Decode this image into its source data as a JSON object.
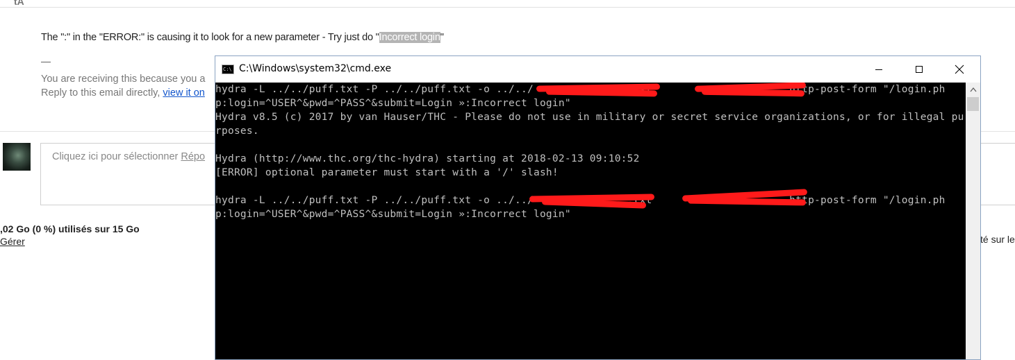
{
  "email": {
    "top_icon": "tA",
    "body_prefix": "The \":\" in the \"ERROR:\" is causing it to look for a new parameter - Try just do \"",
    "body_highlight": "Incorrect login",
    "body_suffix": "\"",
    "signature_dash": "—",
    "notice_line1": "You are receiving this because you a",
    "notice_line2_prefix": "Reply to this email directly, ",
    "notice_link": "view it on",
    "reply_placeholder_prefix": "Cliquez ici pour sélectionner ",
    "reply_placeholder_underlined": "Répo",
    "storage_text": ",02 Go (0 %) utilisés sur 15 Go",
    "manage_link": "Gérer",
    "right_clip": "té sur le"
  },
  "cmd": {
    "title": "C:\\Windows\\system32\\cmd.exe",
    "icon_text": "C:\\",
    "lines": [
      "hydra -L ../../puff.txt -P ../../puff.txt -o ../../               .txt                      http-post-form \"/login.ph",
      "p:login=^USER^&pwd=^PASS^&submit=Login »:Incorrect login\"",
      "Hydra v8.5 (c) 2017 by van Hauser/THC - Please do not use in military or secret service organizations, or for illegal pu",
      "rposes.",
      "",
      "Hydra (http://www.thc.org/thc-hydra) starting at 2018-02-13 09:10:52",
      "[ERROR] optional parameter must start with a '/' slash!",
      "",
      "hydra -L ../../puff.txt -P ../../puff.txt -o ../../               .txt                      http-post-form \"/login.ph",
      "p:login=^USER^&pwd=^PASS^&submit=Login »:Incorrect login\""
    ],
    "redaction_color": "#ff1a1a"
  },
  "colors": {
    "link": "#1155cc",
    "console_bg": "#000000",
    "console_text": "#c0c0c0"
  }
}
